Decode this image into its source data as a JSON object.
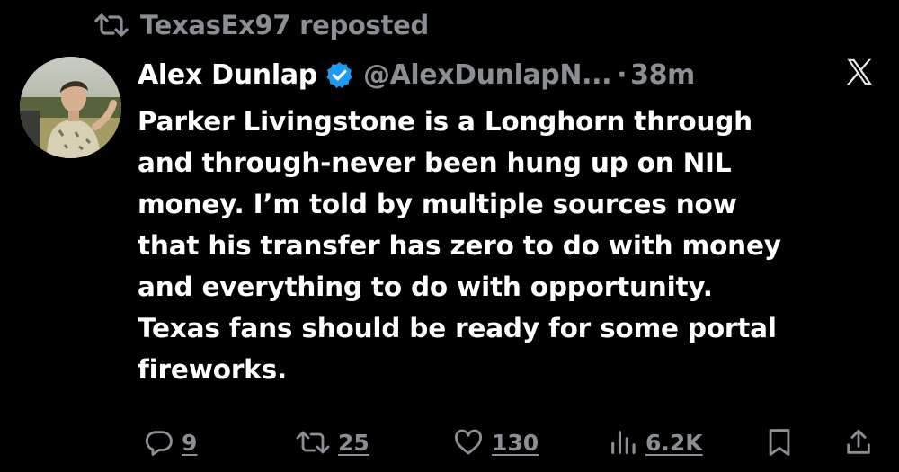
{
  "repost": {
    "text": "TexasEx97 reposted",
    "icon": "repost-icon"
  },
  "author": {
    "name": "Alex Dunlap",
    "handle": "@AlexDunlapN...",
    "separator": "·",
    "time": "38m",
    "verified_icon": "verified-badge-icon",
    "verified_color": "#1d9bf0"
  },
  "platform_icon": "x-logo-icon",
  "tweet": {
    "lines": [
      "Parker Livingstone is a Longhorn through",
      "and through-never been hung up on NIL",
      "money. I’m told by multiple sources now",
      "that his transfer has zero to do with money",
      "and everything to do with opportunity.",
      "Texas fans should be ready for some portal",
      "fireworks."
    ]
  },
  "actions": {
    "replies": "9",
    "reposts": "25",
    "likes": "130",
    "views": "6.2K",
    "reply_icon": "reply-icon",
    "repost_icon": "repost-icon",
    "like_icon": "heart-icon",
    "views_icon": "views-chart-icon",
    "bookmark_icon": "bookmark-icon",
    "share_icon": "share-icon"
  },
  "colors": {
    "background": "#000000",
    "text_primary": "#ffffff",
    "text_secondary": "#8b8f95",
    "accent": "#1d9bf0"
  }
}
